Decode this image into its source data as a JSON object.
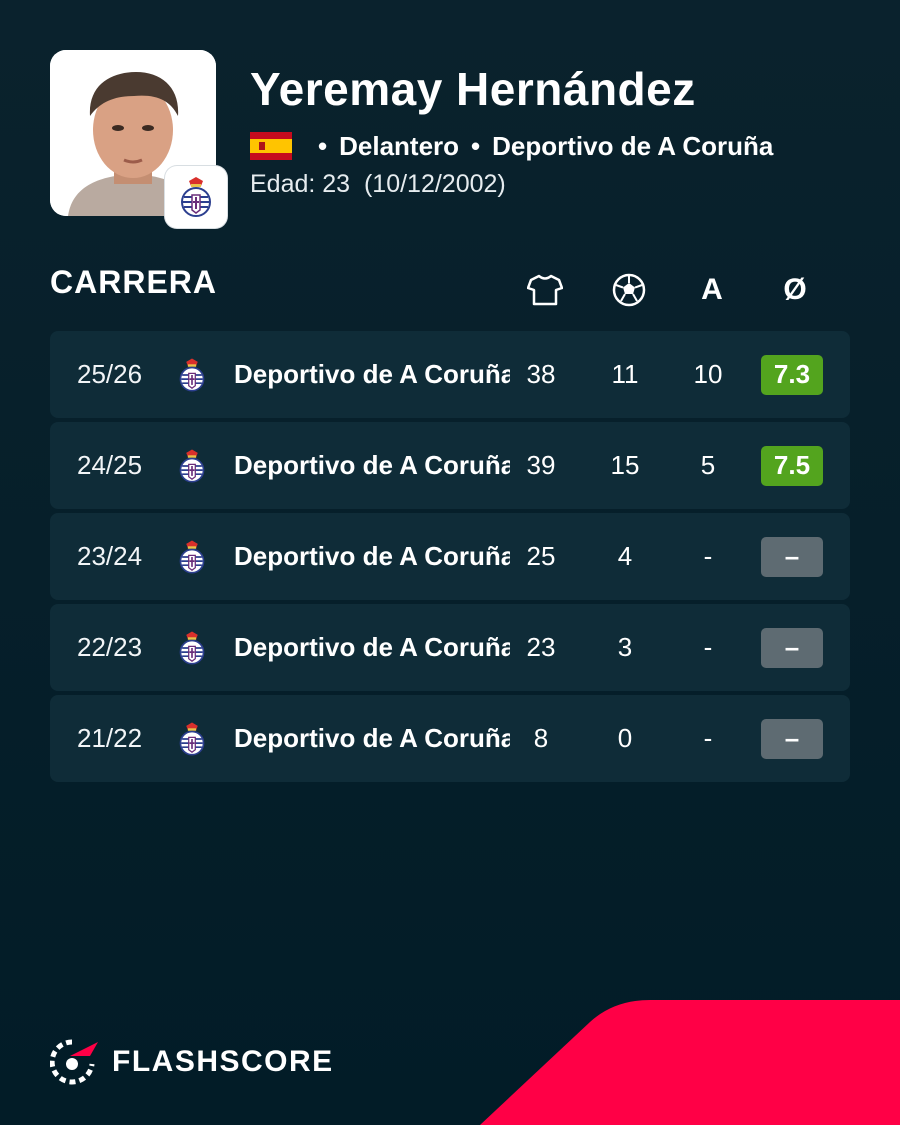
{
  "player": {
    "name": "Yeremay Hernández",
    "position": "Delantero",
    "club": "Deportivo de A Coruña",
    "age_label": "Edad: 23  (10/12/2002)",
    "nationality_flag": "spain-flag-icon"
  },
  "career": {
    "title": "CARRERA",
    "columns": {
      "apps_icon": "shirt-icon",
      "goals_icon": "ball-icon",
      "assists_label": "A",
      "rating_label": "Ø"
    },
    "rows": [
      {
        "season": "25/26",
        "team": "Deportivo de A Coruña",
        "apps": "38",
        "goals": "11",
        "assists": "10",
        "rating": "7.3"
      },
      {
        "season": "24/25",
        "team": "Deportivo de A Coruña",
        "apps": "39",
        "goals": "15",
        "assists": "5",
        "rating": "7.5"
      },
      {
        "season": "23/24",
        "team": "Deportivo de A Coruña",
        "apps": "25",
        "goals": "4",
        "assists": "-",
        "rating": "–"
      },
      {
        "season": "22/23",
        "team": "Deportivo de A Coruña",
        "apps": "23",
        "goals": "3",
        "assists": "-",
        "rating": "–"
      },
      {
        "season": "21/22",
        "team": "Deportivo de A Coruña",
        "apps": "8",
        "goals": "0",
        "assists": "-",
        "rating": "–"
      }
    ]
  },
  "brand": {
    "name": "FLASHSCORE"
  },
  "colors": {
    "background": "#03202c",
    "row": "#0f2c38",
    "rating_good": "#53a41e",
    "rating_none": "#5e6b72",
    "accent_red": "#ff0046"
  }
}
